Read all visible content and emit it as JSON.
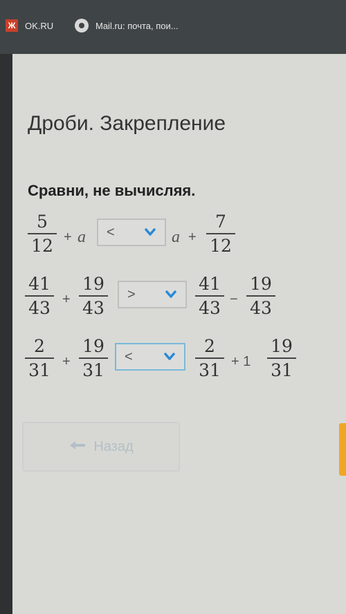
{
  "bookmarks": [
    {
      "label": "OK.RU",
      "icon": "ok-icon"
    },
    {
      "label": "Mail.ru: почта, пои...",
      "icon": "mail-icon"
    }
  ],
  "title": "Дроби. Закрепление",
  "task": "Сравни, не вычисляя.",
  "rows": [
    {
      "left": {
        "frac": {
          "num": "5",
          "den": "12"
        },
        "op": "+",
        "var": "a"
      },
      "select": "<",
      "right": {
        "var": "a",
        "op": "+",
        "frac": {
          "num": "7",
          "den": "12"
        }
      }
    },
    {
      "left": {
        "frac1": {
          "num": "41",
          "den": "43"
        },
        "op": "+",
        "frac2": {
          "num": "19",
          "den": "43"
        }
      },
      "select": ">",
      "right": {
        "frac1": {
          "num": "41",
          "den": "43"
        },
        "op": "−",
        "frac2": {
          "num": "19",
          "den": "43"
        }
      }
    },
    {
      "left": {
        "frac1": {
          "num": "2",
          "den": "31"
        },
        "op": "+",
        "frac2": {
          "num": "19",
          "den": "31"
        }
      },
      "select": "<",
      "right": {
        "frac1": {
          "num": "2",
          "den": "31"
        },
        "op": "+ 1",
        "frac2": {
          "num": "19",
          "den": "31"
        }
      }
    }
  ],
  "back_button": {
    "label": "Назад",
    "icon": "arrow-left-icon"
  },
  "colors": {
    "accent": "#7ab8d8",
    "chevron": "#2a8ad6",
    "orange": "#f0a624"
  }
}
